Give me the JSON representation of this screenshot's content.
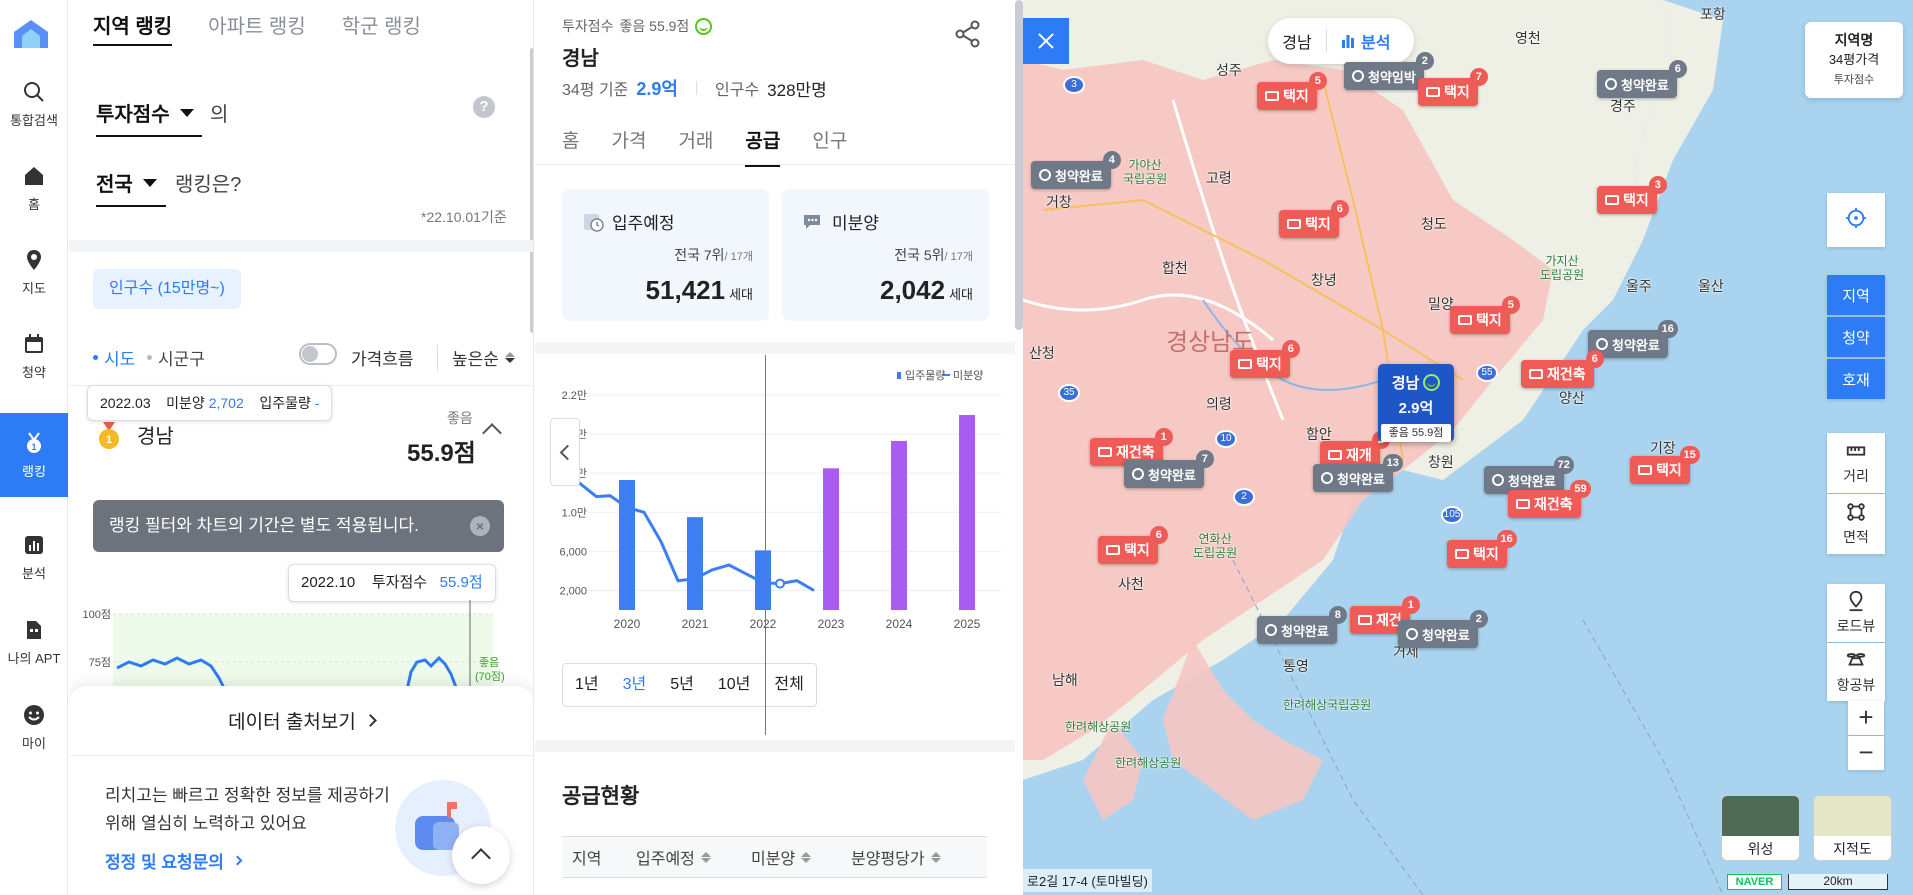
{
  "nav": [
    {
      "label": "통합검색",
      "icon": "search-icon"
    },
    {
      "label": "홈",
      "icon": "home-icon"
    },
    {
      "label": "지도",
      "icon": "map-pin-icon"
    },
    {
      "label": "청약",
      "icon": "calendar-icon"
    },
    {
      "label": "랭킹",
      "icon": "medal-icon",
      "active": true
    },
    {
      "label": "분석",
      "icon": "bar-chart-icon"
    },
    {
      "label": "나의 APT",
      "icon": "building-icon"
    },
    {
      "label": "마이",
      "icon": "smile-icon"
    }
  ],
  "ranking": {
    "tabs": [
      "지역 랭킹",
      "아파트 랭킹",
      "학군 랭킹"
    ],
    "metric_select": "투자점수",
    "metric_suffix": "의",
    "scope_select": "전국",
    "scope_suffix": "랭킹은?",
    "basis_date": "*22.10.01기준",
    "chip": "인구수 (15만명~)",
    "radio_sido": "시도",
    "radio_sigungu": "시군구",
    "toggle_label": "가격흐름",
    "sort": "높은순",
    "top": {
      "name": "경남",
      "grade": "좋음",
      "score": "55.9점"
    },
    "notice": "랭킹 필터와 차트의 기간은 별도 적용됩니다.",
    "notice_close": "×",
    "tooltip": {
      "date": "2022.10",
      "label": "투자점수",
      "value": "55.9점"
    },
    "chart_y": [
      "100점",
      "75점"
    ],
    "chart_band": [
      "좋음",
      "(70점)"
    ],
    "data_source_btn": "데이터 출처보기",
    "info_text": "리치고는 빠르고 정확한 정보를 제공하기 위해 열심히 노력하고 있어요",
    "info_link": "정정 및 요청문의"
  },
  "detail": {
    "score_label": "투자점수",
    "score_value": "좋음 55.9점",
    "region": "경남",
    "price_basis": "34평 기준",
    "price": "2.9억",
    "pop_label": "인구수",
    "pop": "328만명",
    "tabs": [
      "홈",
      "가격",
      "거래",
      "공급",
      "인구"
    ],
    "active_tab": "공급",
    "cards": [
      {
        "label": "입주예정",
        "rank": "전국 7위",
        "rank_total": "/ 17개",
        "value": "51,421",
        "unit": "세대"
      },
      {
        "label": "미분양",
        "rank": "전국 5위",
        "rank_total": "/ 17개",
        "value": "2,042",
        "unit": "세대"
      }
    ],
    "chart_tooltip": {
      "date": "2022.03",
      "a_label": "미분양",
      "a_value": "2,702",
      "b_label": "입주물량",
      "b_value": "-"
    },
    "periods": [
      "1년",
      "3년",
      "5년",
      "10년",
      "전체"
    ],
    "active_period": "3년",
    "supply_title": "공급현황",
    "supply_cols": [
      "지역",
      "입주예정",
      "미분양",
      "분양평당가"
    ]
  },
  "chart_data": {
    "type": "bar",
    "legend": [
      "입주물량",
      "미분양"
    ],
    "y_ticks": [
      "2,000",
      "6,000",
      "1.0만",
      "1.4만",
      "1.8만",
      "2.2만"
    ],
    "ylim": [
      0,
      22000
    ],
    "categories": [
      "2020",
      "2021",
      "2022",
      "2023",
      "2024",
      "2025"
    ],
    "series": [
      {
        "name": "입주물량",
        "values": [
          13300,
          9500,
          6100,
          14500,
          17300,
          19950
        ]
      },
      {
        "name": "미분양",
        "x": [
          2019.05,
          2019.3,
          2019.55,
          2019.75,
          2020.0,
          2020.25,
          2020.5,
          2020.75,
          2021.0,
          2021.25,
          2021.5,
          2021.75,
          2022.0,
          2022.25,
          2022.5,
          2022.75
        ],
        "values": [
          15800,
          13000,
          11600,
          11700,
          10500,
          10000,
          7000,
          3000,
          3200,
          4100,
          4600,
          3700,
          2800,
          2702,
          3000,
          2000
        ]
      }
    ],
    "colors": {
      "supply": "#3d7ef2",
      "forecast": "#a85cf2",
      "unsold": "#3d7ef2"
    }
  },
  "map": {
    "toggle_left": "경남",
    "toggle_right": "분석",
    "legend": [
      "지역명",
      "34평가격",
      "투자점수"
    ],
    "side_buttons": [
      "지역",
      "청약",
      "호재"
    ],
    "tools": [
      "거리",
      "면적",
      "로드뷰",
      "항공뷰"
    ],
    "zoom_in": "+",
    "zoom_out": "−",
    "thumbs": [
      "위성",
      "지적도"
    ],
    "naver": "NAVER",
    "scale": "20km",
    "address": "로2길 17-4 (토마빌딩)",
    "main_marker": {
      "name": "경남",
      "price": "2.9억",
      "score": "좋음 55.9점"
    },
    "places": [
      {
        "t": "포항",
        "big": false
      },
      {
        "t": "영천",
        "big": false
      },
      {
        "t": "성주",
        "big": false
      },
      {
        "t": "경주",
        "big": false
      },
      {
        "t": "고령",
        "big": false
      },
      {
        "t": "거창",
        "big": false
      },
      {
        "t": "청도",
        "big": false
      },
      {
        "t": "울주",
        "big": false
      },
      {
        "t": "울산",
        "big": false
      },
      {
        "t": "합천",
        "big": false
      },
      {
        "t": "경상남도",
        "big": true
      },
      {
        "t": "창녕",
        "big": false
      },
      {
        "t": "밀양",
        "big": false
      },
      {
        "t": "산청",
        "big": false
      },
      {
        "t": "의령",
        "big": false
      },
      {
        "t": "양산",
        "big": false
      },
      {
        "t": "함안",
        "big": false
      },
      {
        "t": "기장",
        "big": false
      },
      {
        "t": "사천",
        "big": false
      },
      {
        "t": "거제",
        "big": false
      },
      {
        "t": "통영",
        "big": false
      },
      {
        "t": "남해",
        "big": false
      },
      {
        "t": "창원",
        "big": false
      }
    ],
    "parks": [
      "가야산\n국립공원",
      "가지산\n도립공원",
      "연화산\n도립공원",
      "한려해상국립공원",
      "한려해상공원",
      "한려해상공원"
    ],
    "markers": [
      {
        "kind": "red",
        "label": "택지",
        "count": "5"
      },
      {
        "kind": "gray",
        "label": "청약임박",
        "count": "2"
      },
      {
        "kind": "red",
        "label": "택지",
        "count": "7"
      },
      {
        "kind": "gray",
        "label": "청약완료",
        "count": "6"
      },
      {
        "kind": "gray",
        "label": "청약완료",
        "count": "4"
      },
      {
        "kind": "red",
        "label": "택지",
        "count": "6"
      },
      {
        "kind": "red",
        "label": "택지",
        "count": "3"
      },
      {
        "kind": "red",
        "label": "택지",
        "count": "5"
      },
      {
        "kind": "gray",
        "label": "청약완료",
        "count": "16"
      },
      {
        "kind": "red",
        "label": "택지",
        "count": "6"
      },
      {
        "kind": "red",
        "label": "재건축",
        "count": "6"
      },
      {
        "kind": "red",
        "label": "재건축",
        "count": "1"
      },
      {
        "kind": "gray",
        "label": "청약완료",
        "count": "7"
      },
      {
        "kind": "red",
        "label": "재개",
        "count": "2"
      },
      {
        "kind": "gray",
        "label": "청약완료",
        "count": "13"
      },
      {
        "kind": "gray",
        "label": "청약완료",
        "count": "72"
      },
      {
        "kind": "red",
        "label": "택지",
        "count": "15"
      },
      {
        "kind": "red",
        "label": "재건축",
        "count": "59"
      },
      {
        "kind": "red",
        "label": "택지",
        "count": "6"
      },
      {
        "kind": "red",
        "label": "택지",
        "count": "16"
      },
      {
        "kind": "gray",
        "label": "청약완료",
        "count": "8"
      },
      {
        "kind": "red",
        "label": "재건",
        "count": "1"
      },
      {
        "kind": "gray",
        "label": "청약완료",
        "count": "2"
      }
    ],
    "roads": [
      "3",
      "35",
      "10",
      "2",
      "55",
      "105"
    ]
  }
}
